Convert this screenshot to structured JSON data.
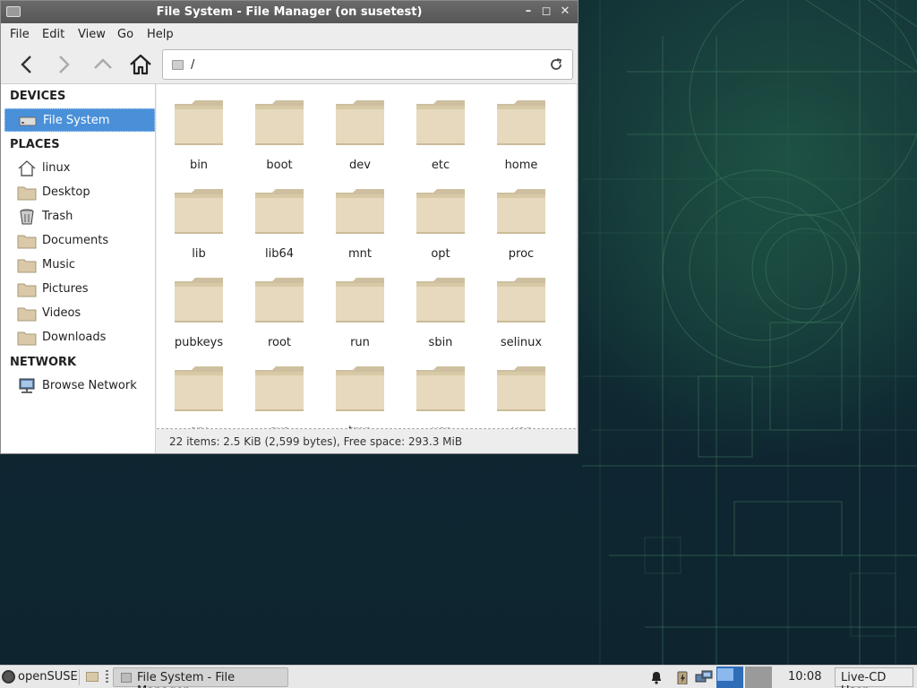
{
  "window": {
    "title": "File System - File Manager (on susetest)"
  },
  "menubar": {
    "items": [
      "File",
      "Edit",
      "View",
      "Go",
      "Help"
    ]
  },
  "toolbar": {
    "icons": [
      "back-icon",
      "forward-icon",
      "up-icon",
      "home-icon"
    ],
    "location_value": "/"
  },
  "sidebar": {
    "devices_heading": "DEVICES",
    "devices": [
      {
        "label": "File System",
        "icon": "drive-icon",
        "selected": true
      }
    ],
    "places_heading": "PLACES",
    "places": [
      {
        "label": "linux",
        "icon": "home-icon"
      },
      {
        "label": "Desktop",
        "icon": "desktop-folder-icon"
      },
      {
        "label": "Trash",
        "icon": "trash-icon"
      },
      {
        "label": "Documents",
        "icon": "documents-folder-icon"
      },
      {
        "label": "Music",
        "icon": "music-folder-icon"
      },
      {
        "label": "Pictures",
        "icon": "pictures-folder-icon"
      },
      {
        "label": "Videos",
        "icon": "videos-folder-icon"
      },
      {
        "label": "Downloads",
        "icon": "downloads-folder-icon"
      }
    ],
    "network_heading": "NETWORK",
    "network": [
      {
        "label": "Browse Network",
        "icon": "network-icon"
      }
    ]
  },
  "folders": [
    "bin",
    "boot",
    "dev",
    "etc",
    "home",
    "lib",
    "lib64",
    "mnt",
    "opt",
    "proc",
    "pubkeys",
    "root",
    "run",
    "sbin",
    "selinux",
    "srv",
    "sys",
    "tmp",
    "usr",
    "var"
  ],
  "statusbar": {
    "text": "22 items: 2.5 KiB (2,599 bytes), Free space: 293.3 MiB"
  },
  "taskbar": {
    "start_label": "openSUSE",
    "task_label": "File System - File Manager",
    "clock": "10:08",
    "user_label": "Live-CD User"
  },
  "colors": {
    "selection": "#4a90d9",
    "folder": "#e6d9bd",
    "titlebar": "#5e5e5e",
    "desktop": "#0f2630"
  }
}
